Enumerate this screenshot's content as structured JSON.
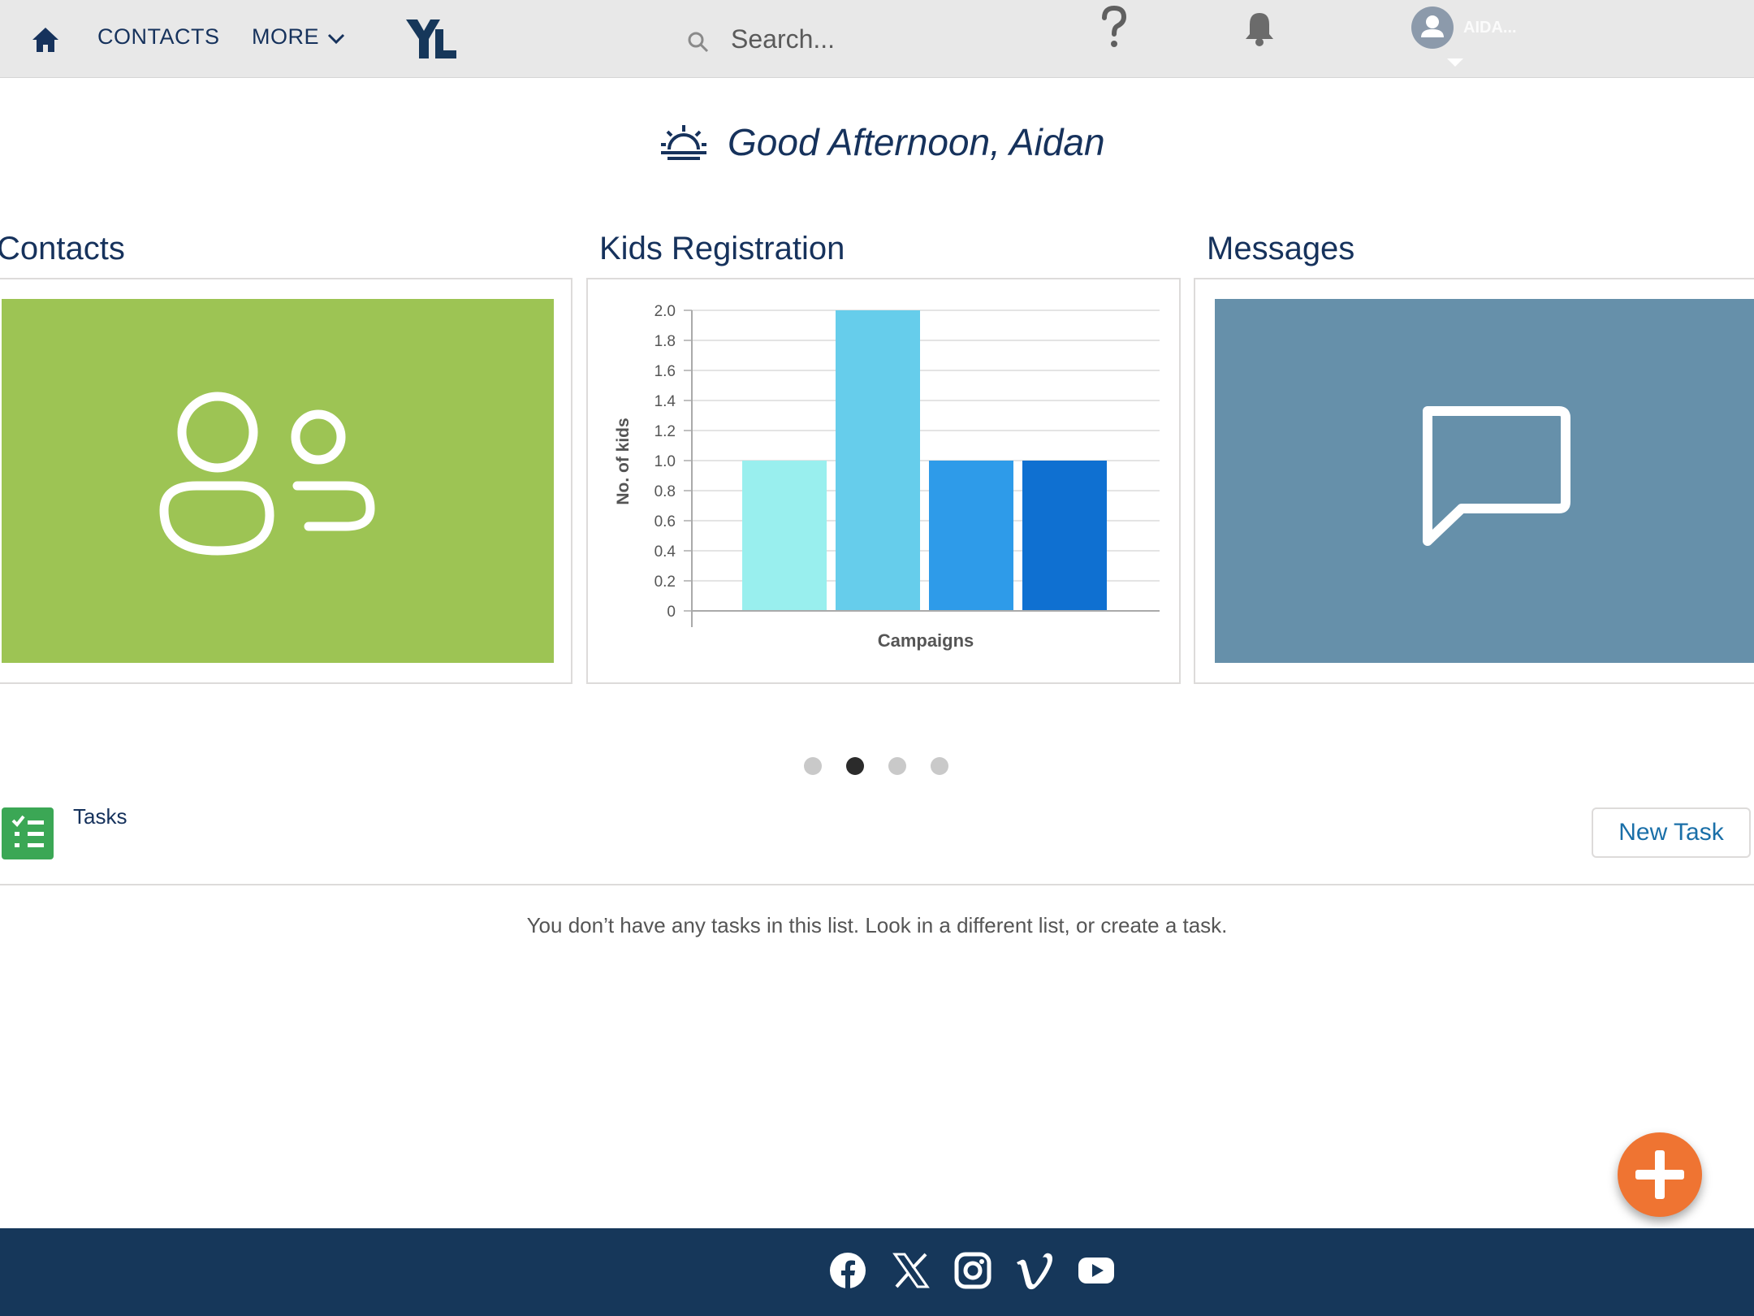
{
  "nav": {
    "contacts_label": "CONTACTS",
    "more_label": "MORE",
    "search_placeholder": "Search...",
    "user_name": "AIDA..."
  },
  "greeting": "Good Afternoon, Aidan",
  "cards": {
    "contacts_title": "Contacts",
    "chart_title": "Kids Registration",
    "messages_title": "Messages"
  },
  "chart_data": {
    "type": "bar",
    "title": "Kids Registration",
    "xlabel": "Campaigns",
    "ylabel": "No. of kids",
    "ylim": [
      0,
      2.0
    ],
    "yticks": [
      "2.0",
      "1.8",
      "1.6",
      "1.4",
      "1.2",
      "1.0",
      "0.8",
      "0.6",
      "0.4",
      "0.2",
      "0"
    ],
    "values": [
      1,
      2,
      1,
      1
    ],
    "colors": [
      "#99efee",
      "#66cdeb",
      "#2e9be9",
      "#0f70d1"
    ],
    "grid": true
  },
  "carousel": {
    "dot_count": 4,
    "active_index": 1
  },
  "tasks": {
    "title": "Tasks",
    "new_task_label": "New Task",
    "empty_message": "You don’t have any tasks in this list. Look in a different list, or create a task."
  },
  "footer": {
    "social_icons": [
      "facebook-icon",
      "x-icon",
      "instagram-icon",
      "vimeo-icon",
      "youtube-icon"
    ]
  },
  "colors": {
    "nav_bg": "#e8e8e8",
    "brand_navy": "#16325c",
    "contacts_tile": "#9dc454",
    "messages_tile": "#6690aa",
    "tasks_green": "#3ba755",
    "fab_orange": "#ef7432",
    "footer_bg": "#16375a"
  }
}
